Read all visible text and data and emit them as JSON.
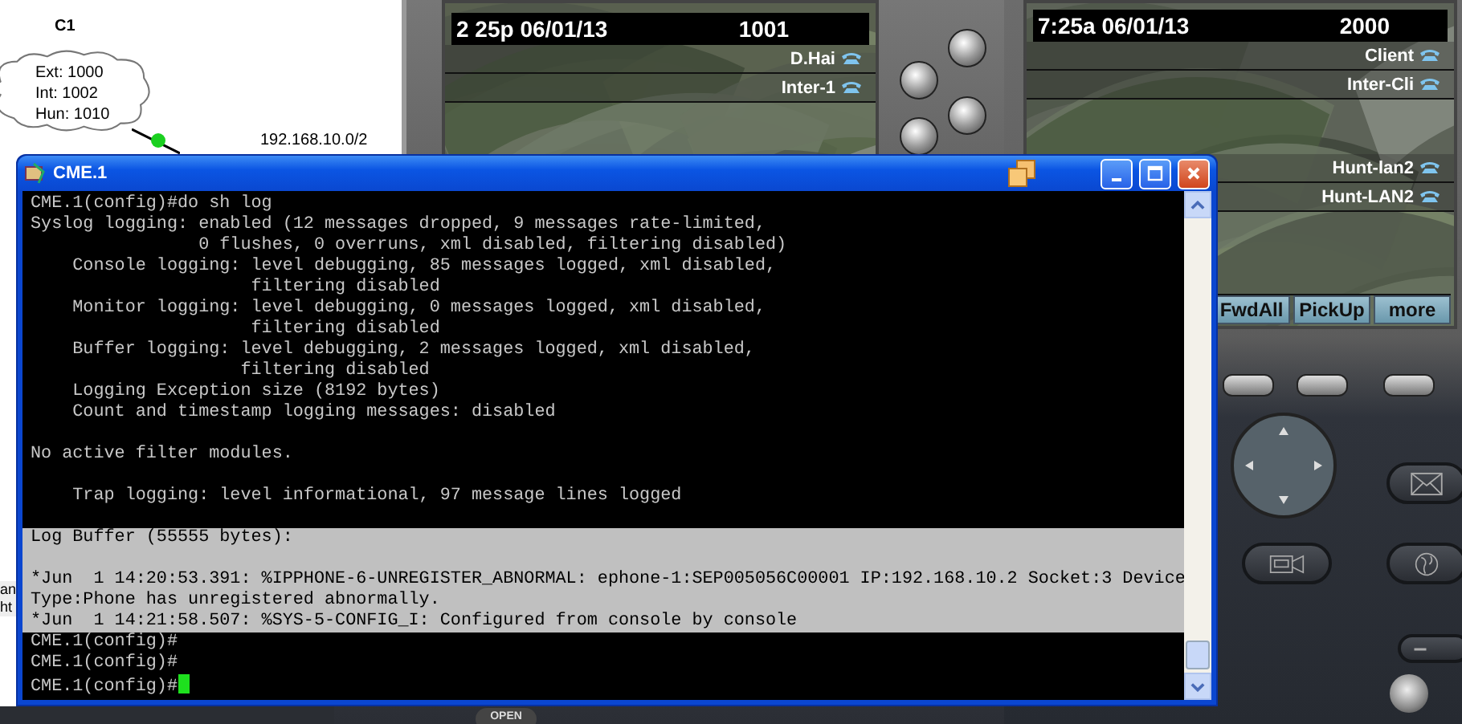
{
  "topology": {
    "cloud_title": "C1",
    "cloud_lines": [
      "Ext: 1000",
      "Int: 1002",
      "Hun: 1010"
    ],
    "network_label": "192.168.10.0/2",
    "side_fragments": [
      "an",
      "ht"
    ]
  },
  "phone_left": {
    "time": "2 25p 06/01/13",
    "extension": "1001",
    "lines": [
      {
        "label": "D.Hai"
      },
      {
        "label": "Inter-1"
      }
    ],
    "bottom_key": "OPEN"
  },
  "phone_right": {
    "time": "7:25a 06/01/13",
    "extension": "2000",
    "line_groups": [
      [
        {
          "label": "Client"
        },
        {
          "label": "Inter-Cli"
        }
      ],
      [
        {
          "label": "Hunt-lan2"
        },
        {
          "label": "Hunt-LAN2"
        }
      ]
    ],
    "softkeys": [
      "FwdAll",
      "PickUp",
      "more"
    ]
  },
  "terminal": {
    "title": "CME.1",
    "cursor": true,
    "lines": [
      {
        "text": "CME.1(config)#do sh log",
        "selected": false
      },
      {
        "text": "Syslog logging: enabled (12 messages dropped, 9 messages rate-limited,",
        "selected": false
      },
      {
        "text": "                0 flushes, 0 overruns, xml disabled, filtering disabled)",
        "selected": false
      },
      {
        "text": "    Console logging: level debugging, 85 messages logged, xml disabled,",
        "selected": false
      },
      {
        "text": "                     filtering disabled",
        "selected": false
      },
      {
        "text": "    Monitor logging: level debugging, 0 messages logged, xml disabled,",
        "selected": false
      },
      {
        "text": "                     filtering disabled",
        "selected": false
      },
      {
        "text": "    Buffer logging: level debugging, 2 messages logged, xml disabled,",
        "selected": false
      },
      {
        "text": "                    filtering disabled",
        "selected": false
      },
      {
        "text": "    Logging Exception size (8192 bytes)",
        "selected": false
      },
      {
        "text": "    Count and timestamp logging messages: disabled",
        "selected": false
      },
      {
        "selected": false
      },
      {
        "text": "No active filter modules.",
        "selected": false
      },
      {
        "selected": false
      },
      {
        "text": "    Trap logging: level informational, 97 message lines logged",
        "selected": false
      },
      {
        "selected": false
      },
      {
        "text": "Log Buffer (55555 bytes):",
        "selected": true
      },
      {
        "selected": true
      },
      {
        "text": "*Jun  1 14:20:53.391: %IPPHONE-6-UNREGISTER_ABNORMAL: ephone-1:SEP005056C00001 IP:192.168.10.2 Socket:3 Device",
        "selected": true
      },
      {
        "text": "Type:Phone has unregistered abnormally.",
        "selected": true
      },
      {
        "text": "*Jun  1 14:21:58.507: %SYS-5-CONFIG_I: Configured from console by console",
        "selected": true
      },
      {
        "text": "CME.1(config)#",
        "selected": false
      },
      {
        "text": "CME.1(config)#",
        "selected": false
      },
      {
        "text": "CME.1(config)#",
        "selected": false
      }
    ]
  }
}
